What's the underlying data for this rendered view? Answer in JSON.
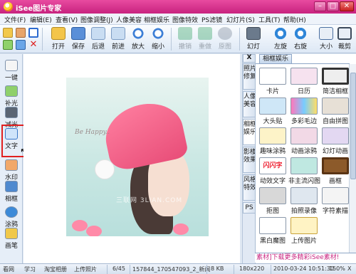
{
  "window": {
    "title": "iSee图片专家"
  },
  "menu": [
    "文件(F)",
    "编辑(E)",
    "查看(V)",
    "图像调整(J)",
    "人像美容",
    "相框娱乐",
    "图像特效",
    "PS滤镜",
    "幻灯片(S)",
    "工具(T)",
    "帮助(H)"
  ],
  "toolbar": {
    "open": "打开",
    "save": "保存",
    "back": "后退",
    "forward": "前进",
    "zoom_in": "放大",
    "zoom_out": "缩小",
    "undo": "撤销",
    "redo": "重做",
    "original": "原图",
    "slideshow": "幻灯",
    "rotate_left": "左旋",
    "rotate_right": "右旋",
    "size": "大小",
    "crop": "裁剪"
  },
  "left_tools": [
    "一键",
    "补光",
    "减光",
    "文字",
    "水印",
    "相框",
    "涂鸦",
    "画笔"
  ],
  "vtabs": [
    "X",
    "照片\n修复",
    "人像\n美容",
    "相框\n娱乐",
    "影楼\n效果",
    "风格\n特效",
    "PS"
  ],
  "right_panel": {
    "tab": "相框娱乐",
    "items": [
      "卡片",
      "日历",
      "简洁相框",
      "大头贴",
      "多彩毛边",
      "自由拼图",
      "趣味涂鸦",
      "动画涂鸦",
      "幻灯动画",
      "动效文字",
      "非主流闪图",
      "画框",
      "拒图",
      "拍照录像",
      "字符素描",
      "黑白魔图",
      "上传图片"
    ],
    "footer": "素材]下载更多精彩iSee素材!"
  },
  "photo": {
    "caption": "Be Happy..",
    "watermark": "三联网 3LIAN.COM"
  },
  "status": [
    "看网",
    "学习",
    "淘宝相册",
    "上传照片",
    "6/45",
    "157844_170547093_2_新闻",
    "8 KB",
    "180x220",
    "2010-03-24 10:51:30",
    "150%",
    "X"
  ],
  "colors": {
    "titlebar": "#d8348e",
    "accent": "#e02020"
  }
}
